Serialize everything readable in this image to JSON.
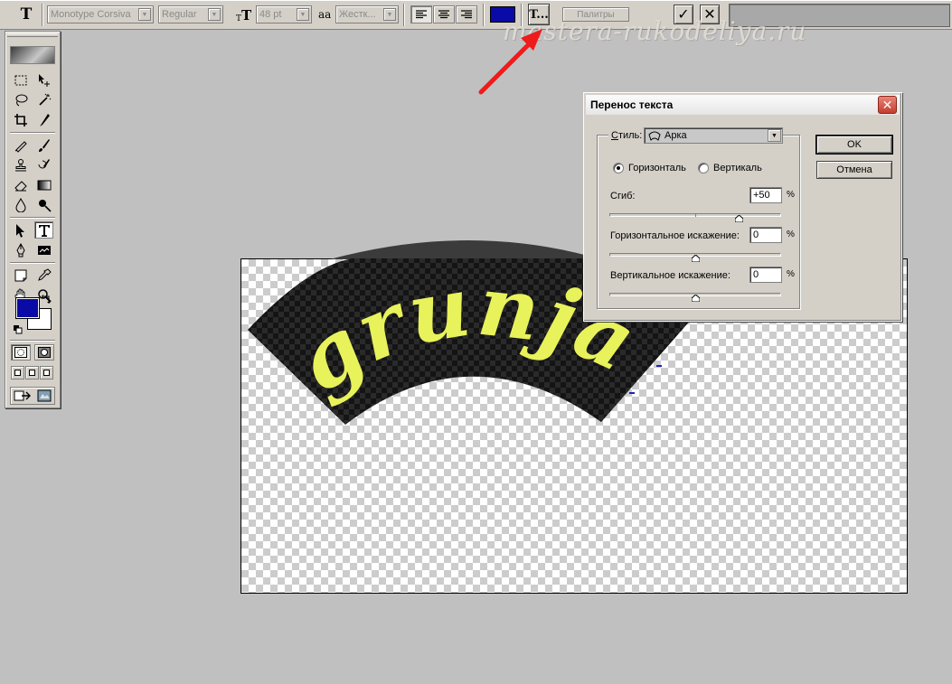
{
  "options_bar": {
    "font_family": "Monotype Corsiva",
    "font_style": "Regular",
    "font_size": "48 pt",
    "anti_alias": "Жестк...",
    "text_color": "#0a0aa6",
    "warp_button_label": "T...",
    "palettes_label": "Палитры",
    "tool_preset_glyph": "T",
    "font_size_glyph": "T",
    "anti_alias_glyph": "aa",
    "commit_glyph": "✓",
    "cancel_glyph": "✕"
  },
  "watermark": {
    "text": "mastera-rukodeliya.ru"
  },
  "canvas": {
    "text": "grunja",
    "text_color": "#e8f25a",
    "fill_color": "#1e1e1e"
  },
  "toolbox": {
    "foreground_color": "#0a0aa6",
    "background_color": "#ffffff"
  },
  "warp_dialog": {
    "title": "Перенос текста",
    "close_glyph": "✕",
    "style_label_prefix": "С",
    "style_label_rest": "тиль:",
    "style_value": "Арка",
    "orientation": {
      "horizontal_label": "Горизонталь",
      "vertical_label": "Вертикаль",
      "selected": "horizontal"
    },
    "bend": {
      "label": "Сгиб:",
      "value": "+50",
      "unit": "%"
    },
    "horizontal_distortion": {
      "label": "Горизонтальное искажение:",
      "value": "0",
      "unit": "%"
    },
    "vertical_distortion": {
      "label": "Вертикальное искажение:",
      "value": "0",
      "unit": "%"
    },
    "ok_label": "OK",
    "cancel_label": "Отмена"
  }
}
